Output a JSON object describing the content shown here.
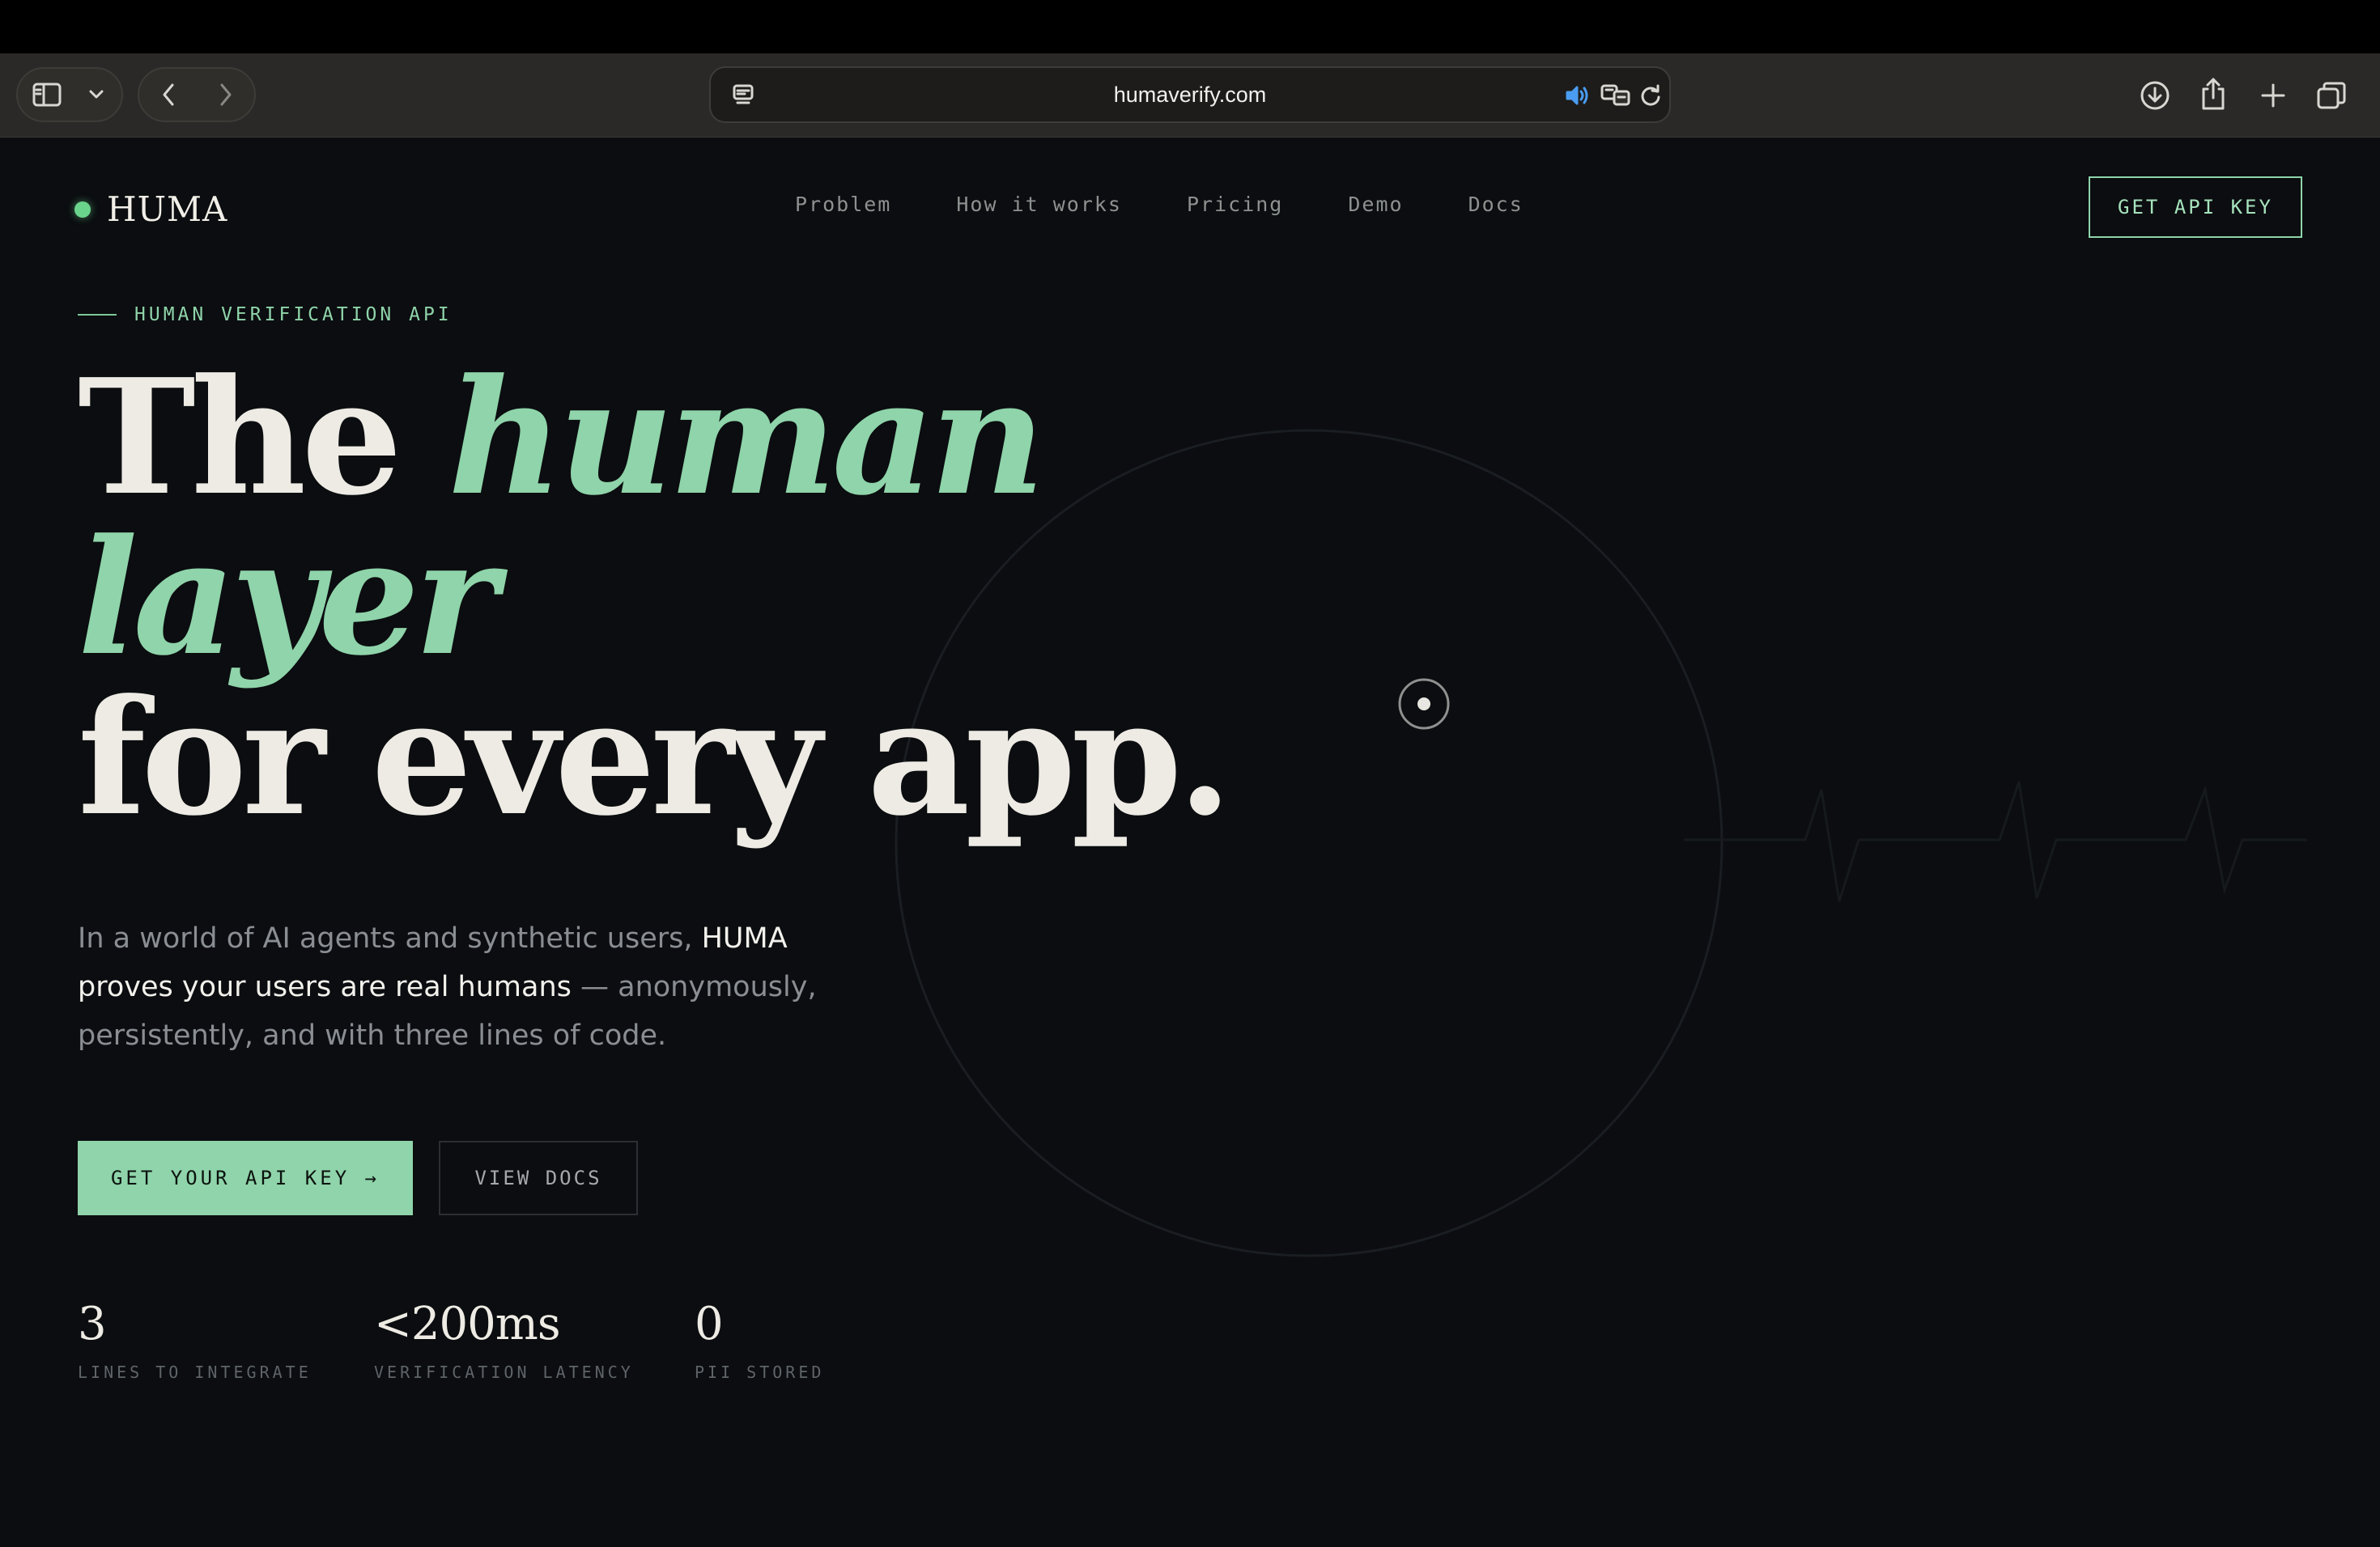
{
  "browser": {
    "url": "humaverify.com"
  },
  "site": {
    "logo_text": "HUMA",
    "nav": [
      {
        "label": "Problem"
      },
      {
        "label": "How it works"
      },
      {
        "label": "Pricing"
      },
      {
        "label": "Demo"
      },
      {
        "label": "Docs"
      }
    ],
    "header_cta": "GET API KEY"
  },
  "hero": {
    "eyebrow": "HUMAN VERIFICATION API",
    "headline": {
      "part1": "The ",
      "accent1": "human",
      "accent2": "layer",
      "line3": "for every app."
    },
    "lead": {
      "pre": "In a world of AI agents and synthetic users, ",
      "strong": "HUMA proves your users are real humans",
      "post": " — anonymously, persistently, and with three lines of code."
    },
    "primary_cta": "GET YOUR API KEY →",
    "secondary_cta": "VIEW DOCS",
    "stats": [
      {
        "value": "3",
        "label": "LINES TO INTEGRATE"
      },
      {
        "value": "<200ms",
        "label": "VERIFICATION LATENCY"
      },
      {
        "value": "0",
        "label": "PII STORED"
      }
    ]
  },
  "colors": {
    "accent": "#8fd4aa",
    "background": "#0b0d10",
    "logo_dot": "#6bd48c"
  }
}
